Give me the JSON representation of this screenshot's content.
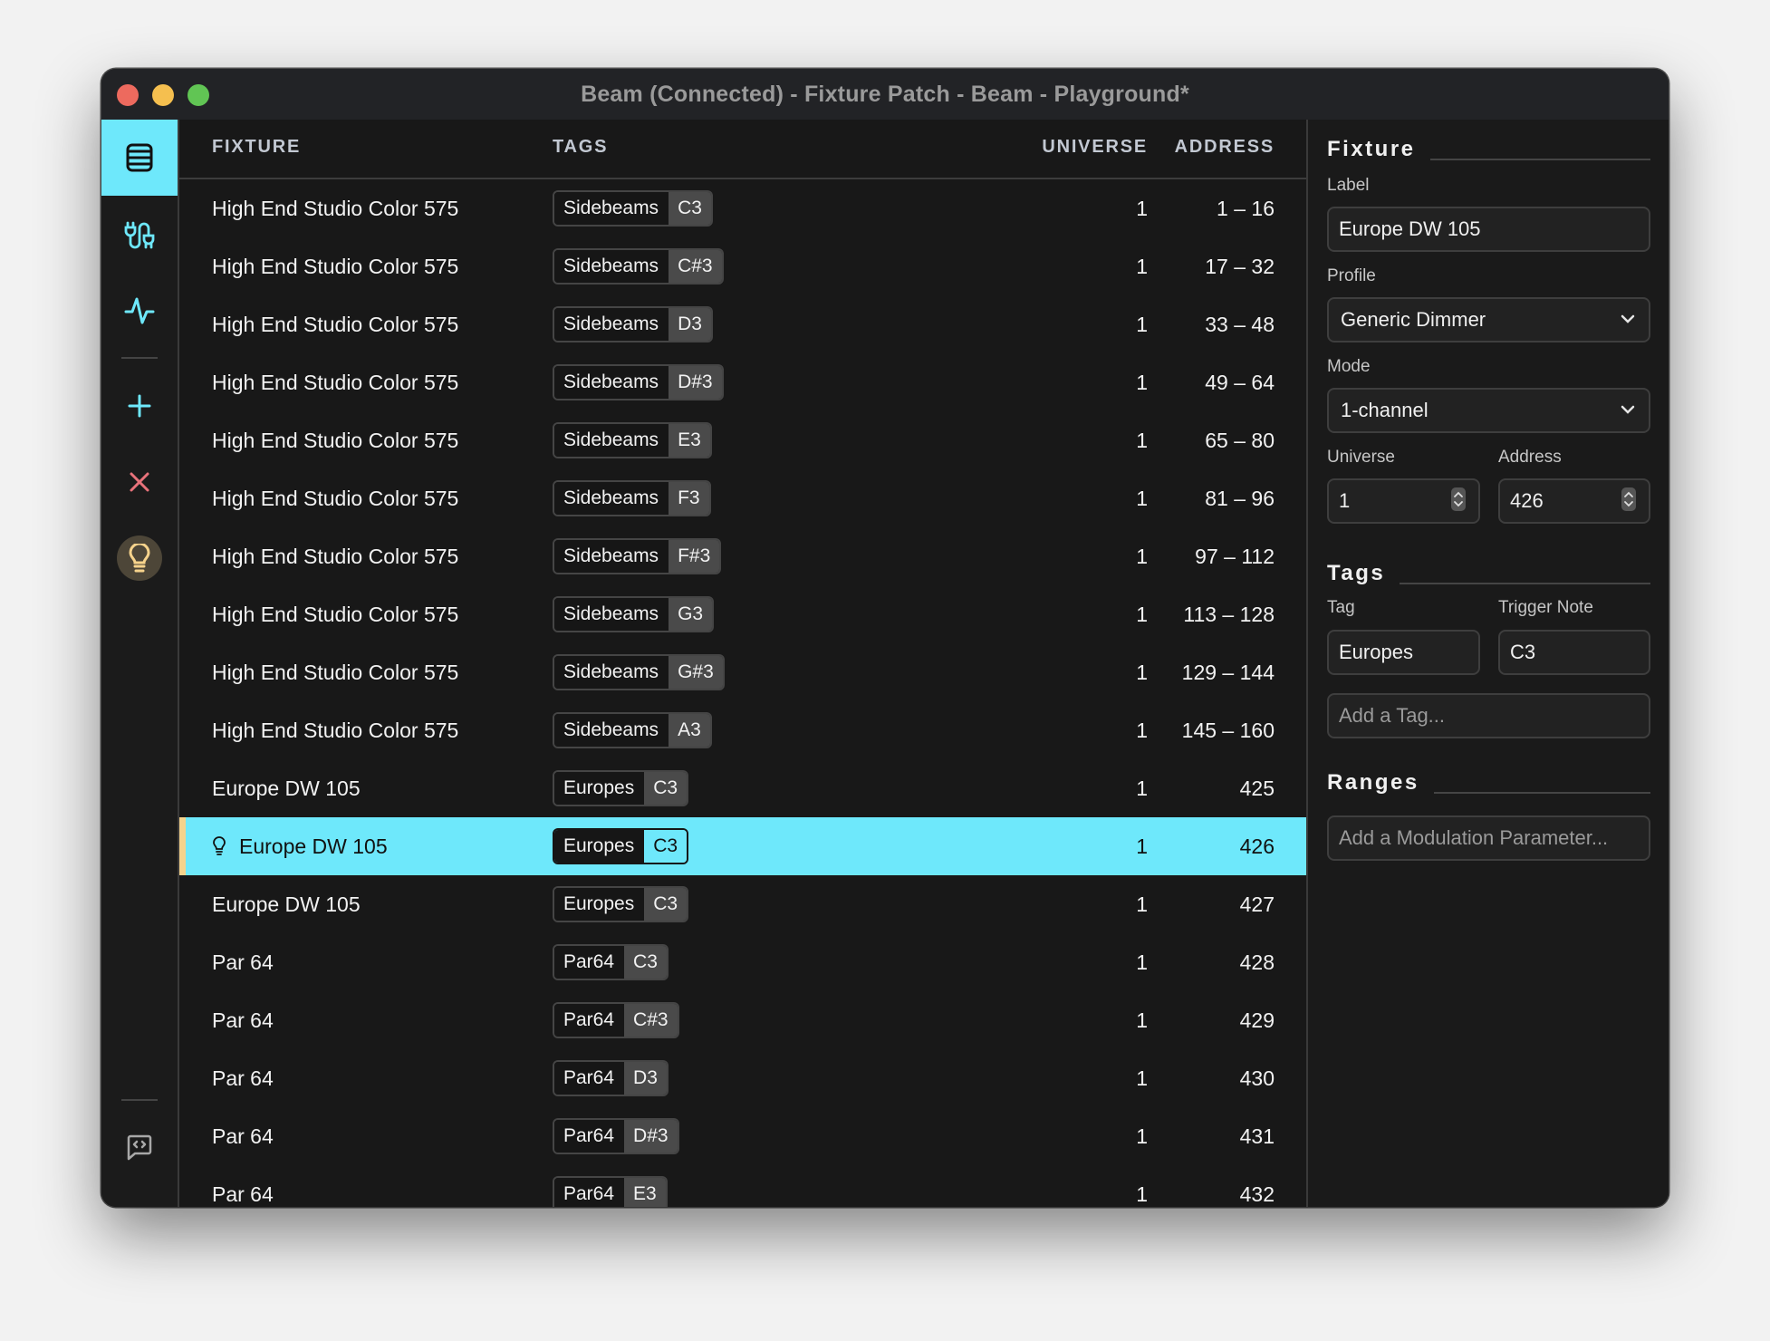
{
  "window": {
    "title": "Beam (Connected) - Fixture Patch - Beam - Playground*"
  },
  "sidebar": {
    "items": [
      {
        "name": "fixture-list",
        "icon": "list-icon",
        "active": true
      },
      {
        "name": "patch",
        "icon": "plug-cable-icon"
      },
      {
        "name": "monitor",
        "icon": "pulse-icon"
      },
      {
        "name": "add-fixture",
        "icon": "plus-icon"
      },
      {
        "name": "remove-fixture",
        "icon": "close-icon"
      },
      {
        "name": "identify",
        "icon": "lightbulb-icon"
      },
      {
        "name": "console",
        "icon": "code-chat-icon"
      },
      {
        "name": "settings",
        "icon": "gear-icon"
      }
    ],
    "colors": {
      "accent": "#6ee8fb",
      "danger": "#e8727a",
      "bulb": "#f6d38c"
    }
  },
  "table": {
    "columns": {
      "fixture": "FIXTURE",
      "tags": "TAGS",
      "universe": "UNIVERSE",
      "address": "ADDRESS"
    },
    "rows": [
      {
        "fixture": "High End Studio Color 575",
        "tag": "Sidebeams",
        "note": "C3",
        "universe": "1",
        "address": "1 – 16"
      },
      {
        "fixture": "High End Studio Color 575",
        "tag": "Sidebeams",
        "note": "C#3",
        "universe": "1",
        "address": "17 – 32"
      },
      {
        "fixture": "High End Studio Color 575",
        "tag": "Sidebeams",
        "note": "D3",
        "universe": "1",
        "address": "33 – 48"
      },
      {
        "fixture": "High End Studio Color 575",
        "tag": "Sidebeams",
        "note": "D#3",
        "universe": "1",
        "address": "49 – 64"
      },
      {
        "fixture": "High End Studio Color 575",
        "tag": "Sidebeams",
        "note": "E3",
        "universe": "1",
        "address": "65 – 80"
      },
      {
        "fixture": "High End Studio Color 575",
        "tag": "Sidebeams",
        "note": "F3",
        "universe": "1",
        "address": "81 – 96"
      },
      {
        "fixture": "High End Studio Color 575",
        "tag": "Sidebeams",
        "note": "F#3",
        "universe": "1",
        "address": "97 – 112"
      },
      {
        "fixture": "High End Studio Color 575",
        "tag": "Sidebeams",
        "note": "G3",
        "universe": "1",
        "address": "113 – 128"
      },
      {
        "fixture": "High End Studio Color 575",
        "tag": "Sidebeams",
        "note": "G#3",
        "universe": "1",
        "address": "129 – 144"
      },
      {
        "fixture": "High End Studio Color 575",
        "tag": "Sidebeams",
        "note": "A3",
        "universe": "1",
        "address": "145 – 160"
      },
      {
        "fixture": "Europe DW 105",
        "tag": "Europes",
        "note": "C3",
        "universe": "1",
        "address": "425"
      },
      {
        "fixture": "Europe DW 105",
        "tag": "Europes",
        "note": "C3",
        "universe": "1",
        "address": "426",
        "selected": true
      },
      {
        "fixture": "Europe DW 105",
        "tag": "Europes",
        "note": "C3",
        "universe": "1",
        "address": "427"
      },
      {
        "fixture": "Par 64",
        "tag": "Par64",
        "note": "C3",
        "universe": "1",
        "address": "428"
      },
      {
        "fixture": "Par 64",
        "tag": "Par64",
        "note": "C#3",
        "universe": "1",
        "address": "429"
      },
      {
        "fixture": "Par 64",
        "tag": "Par64",
        "note": "D3",
        "universe": "1",
        "address": "430"
      },
      {
        "fixture": "Par 64",
        "tag": "Par64",
        "note": "D#3",
        "universe": "1",
        "address": "431"
      },
      {
        "fixture": "Par 64",
        "tag": "Par64",
        "note": "E3",
        "universe": "1",
        "address": "432"
      }
    ]
  },
  "panel": {
    "fixture_heading": "Fixture",
    "label_label": "Label",
    "label_value": "Europe DW 105",
    "profile_label": "Profile",
    "profile_value": "Generic Dimmer",
    "mode_label": "Mode",
    "mode_value": "1-channel",
    "universe_label": "Universe",
    "universe_value": "1",
    "address_label": "Address",
    "address_value": "426",
    "tags_heading": "Tags",
    "tag_label": "Tag",
    "tag_value": "Europes",
    "trigger_label": "Trigger Note",
    "trigger_value": "C3",
    "add_tag_placeholder": "Add a Tag...",
    "ranges_heading": "Ranges",
    "add_param_placeholder": "Add a Modulation Parameter..."
  }
}
